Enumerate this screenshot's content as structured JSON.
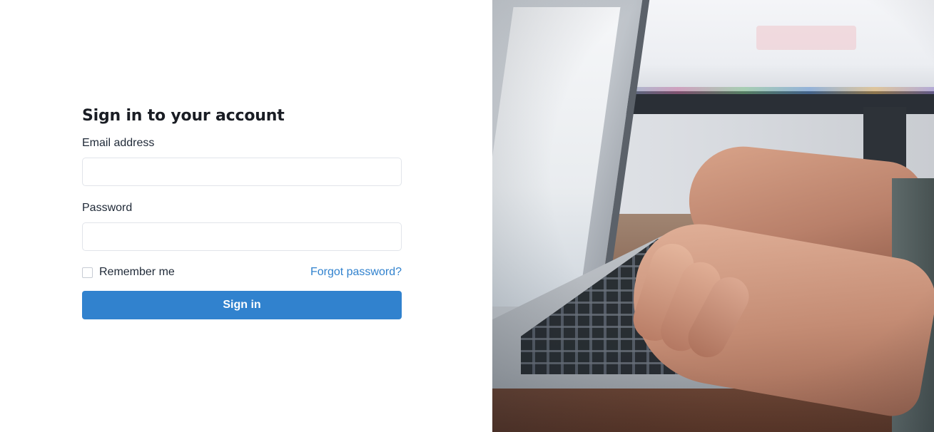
{
  "login": {
    "title": "Sign in to your account",
    "email_label": "Email address",
    "email_value": "",
    "password_label": "Password",
    "password_value": "",
    "remember_label": "Remember me",
    "remember_checked": false,
    "forgot_label": "Forgot password?",
    "submit_label": "Sign in"
  },
  "hero": {
    "image_subject": "hands typing on laptop keyboard"
  },
  "colors": {
    "primary": "#3182ce",
    "title_text": "#1a1d24",
    "body_text": "#1f2937",
    "input_border": "#e1e4ea",
    "background": "#ffffff"
  }
}
